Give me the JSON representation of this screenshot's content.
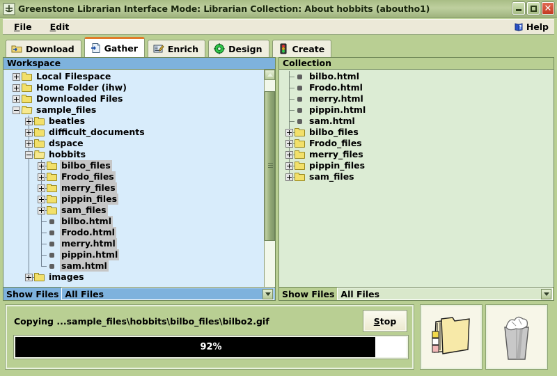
{
  "window": {
    "title": "Greenstone Librarian Interface  Mode: Librarian  Collection: About hobbits (aboutho1)",
    "icon": "greenstone-logo-icon",
    "buttons": {
      "minimize": "minimize-icon",
      "maximize": "maximize-icon",
      "close": "close-icon"
    }
  },
  "menubar": {
    "items": [
      {
        "label": "File",
        "mnemonic": "F"
      },
      {
        "label": "Edit",
        "mnemonic": "E"
      }
    ],
    "help": {
      "label": "Help",
      "icon": "help-book-icon"
    }
  },
  "tabs": [
    {
      "label": "Download",
      "icon": "download-folder-icon",
      "active": false
    },
    {
      "label": "Gather",
      "icon": "gather-page-icon",
      "active": true
    },
    {
      "label": "Enrich",
      "icon": "enrich-pencil-icon",
      "active": false
    },
    {
      "label": "Design",
      "icon": "design-gear-icon",
      "active": false
    },
    {
      "label": "Create",
      "icon": "create-trafficlight-icon",
      "active": false
    }
  ],
  "workspace": {
    "title": "Workspace",
    "rows": [
      {
        "label": "Local Filespace",
        "depth": 0,
        "kind": "folder",
        "handle": "plus",
        "selected": false
      },
      {
        "label": "Home Folder (ihw)",
        "depth": 0,
        "kind": "folder",
        "handle": "plus",
        "selected": false
      },
      {
        "label": "Downloaded Files",
        "depth": 0,
        "kind": "folder",
        "handle": "plus",
        "selected": false
      },
      {
        "label": "sample_files",
        "depth": 0,
        "kind": "folder-open",
        "handle": "minus",
        "selected": false
      },
      {
        "label": "beatles",
        "depth": 1,
        "kind": "folder",
        "handle": "plus",
        "selected": false
      },
      {
        "label": "difficult_documents",
        "depth": 1,
        "kind": "folder",
        "handle": "plus",
        "selected": false
      },
      {
        "label": "dspace",
        "depth": 1,
        "kind": "folder",
        "handle": "plus",
        "selected": false
      },
      {
        "label": "hobbits",
        "depth": 1,
        "kind": "folder-open",
        "handle": "minus",
        "selected": false
      },
      {
        "label": "bilbo_files",
        "depth": 2,
        "kind": "folder",
        "handle": "plus",
        "selected": true
      },
      {
        "label": "Frodo_files",
        "depth": 2,
        "kind": "folder",
        "handle": "plus",
        "selected": true
      },
      {
        "label": "merry_files",
        "depth": 2,
        "kind": "folder",
        "handle": "plus",
        "selected": true
      },
      {
        "label": "pippin_files",
        "depth": 2,
        "kind": "folder",
        "handle": "plus",
        "selected": true
      },
      {
        "label": "sam_files",
        "depth": 2,
        "kind": "folder",
        "handle": "plus",
        "selected": true
      },
      {
        "label": "bilbo.html",
        "depth": 2,
        "kind": "file",
        "handle": "none",
        "selected": true
      },
      {
        "label": "Frodo.html",
        "depth": 2,
        "kind": "file",
        "handle": "none",
        "selected": true
      },
      {
        "label": "merry.html",
        "depth": 2,
        "kind": "file",
        "handle": "none",
        "selected": true
      },
      {
        "label": "pippin.html",
        "depth": 2,
        "kind": "file",
        "handle": "none",
        "selected": true
      },
      {
        "label": "sam.html",
        "depth": 2,
        "kind": "file",
        "handle": "none",
        "selected": true
      },
      {
        "label": "images",
        "depth": 1,
        "kind": "folder",
        "handle": "plus",
        "selected": false
      }
    ],
    "scrollbar": {
      "up": "scroll-up-arrow-icon",
      "down": "scroll-down-arrow-icon"
    },
    "show_files": {
      "label": "Show Files",
      "value": "All Files"
    }
  },
  "collection": {
    "title": "Collection",
    "rows": [
      {
        "label": "bilbo.html",
        "depth": 0,
        "kind": "file",
        "handle": "none",
        "selected": false
      },
      {
        "label": "Frodo.html",
        "depth": 0,
        "kind": "file",
        "handle": "none",
        "selected": false
      },
      {
        "label": "merry.html",
        "depth": 0,
        "kind": "file",
        "handle": "none",
        "selected": false
      },
      {
        "label": "pippin.html",
        "depth": 0,
        "kind": "file",
        "handle": "none",
        "selected": false
      },
      {
        "label": "sam.html",
        "depth": 0,
        "kind": "file",
        "handle": "none",
        "selected": false
      },
      {
        "label": "bilbo_files",
        "depth": 0,
        "kind": "folder",
        "handle": "plus",
        "selected": false
      },
      {
        "label": "Frodo_files",
        "depth": 0,
        "kind": "folder",
        "handle": "plus",
        "selected": false
      },
      {
        "label": "merry_files",
        "depth": 0,
        "kind": "folder",
        "handle": "plus",
        "selected": false
      },
      {
        "label": "pippin_files",
        "depth": 0,
        "kind": "folder",
        "handle": "plus",
        "selected": false
      },
      {
        "label": "sam_files",
        "depth": 0,
        "kind": "folder",
        "handle": "plus",
        "selected": false
      }
    ],
    "show_files": {
      "label": "Show Files",
      "value": "All Files"
    }
  },
  "status": {
    "message": "Copying ...sample_files\\hobbits\\bilbo_files\\bilbo2.gif",
    "stop_label": "Stop",
    "stop_mnemonic": "S",
    "progress_percent": 92,
    "progress_text": "92%"
  },
  "actions": {
    "folder_button": "create-folder-icon",
    "trash_button": "trash-bin-icon"
  },
  "colors": {
    "title_bar": "#b0c391",
    "workspace_bg": "#d8ecfb",
    "workspace_head": "#7eb2dd",
    "collection_bg": "#dcecd4",
    "collection_head": "#b9cf93",
    "accent_tab": "#e07b2a",
    "selection": "#c6c6c6",
    "progress_fill": "#000000",
    "panel_bg": "#b9cf93"
  }
}
